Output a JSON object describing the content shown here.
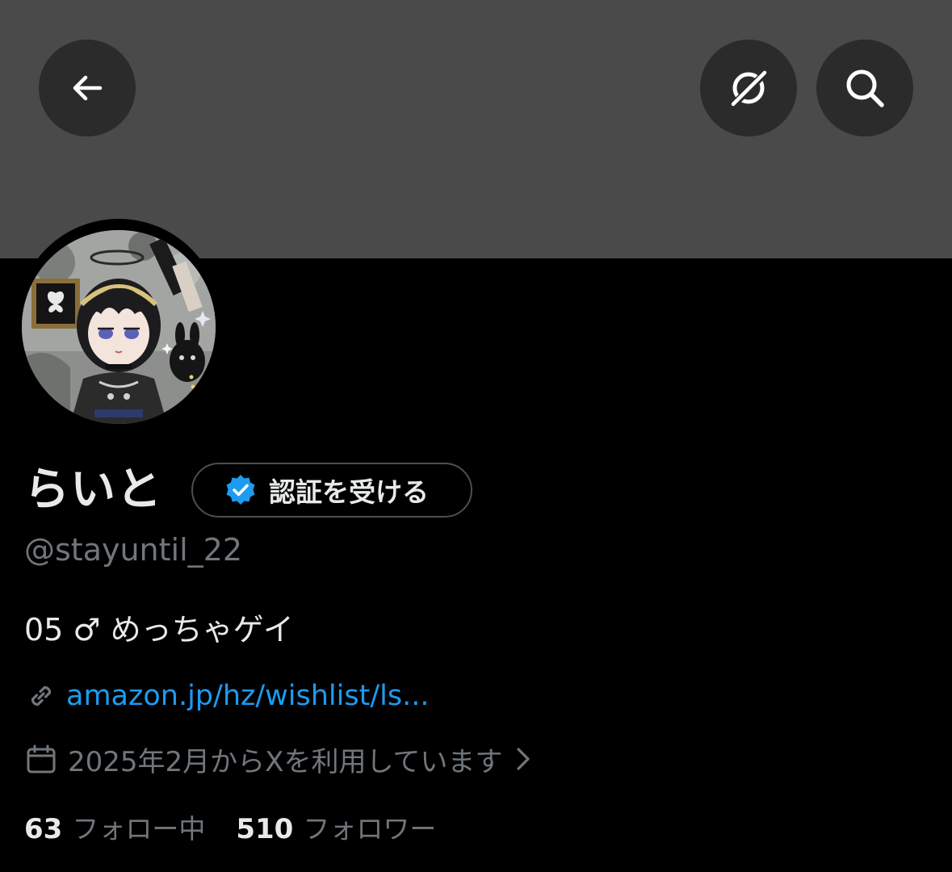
{
  "header": {
    "back_icon": "arrow-left-icon",
    "grok_icon": "grok-icon",
    "search_icon": "search-icon",
    "banner_color": "#4a4a4a"
  },
  "profile": {
    "display_name": "らいと",
    "verify_button_label": "認証を受ける",
    "verify_badge_color": "#1d9bf0",
    "handle": "@stayuntil_22",
    "bio": "05 ♂ めっちゃゲイ",
    "link": "amazon.jp/hz/wishlist/ls...",
    "joined": "2025年2月からXを利用しています",
    "following_count": "63",
    "following_label": "フォロー中",
    "followers_count": "510",
    "followers_label": "フォロワー"
  },
  "colors": {
    "background": "#000000",
    "text_primary": "#e7e9ea",
    "text_secondary": "#71767b",
    "link": "#1d9bf0"
  }
}
